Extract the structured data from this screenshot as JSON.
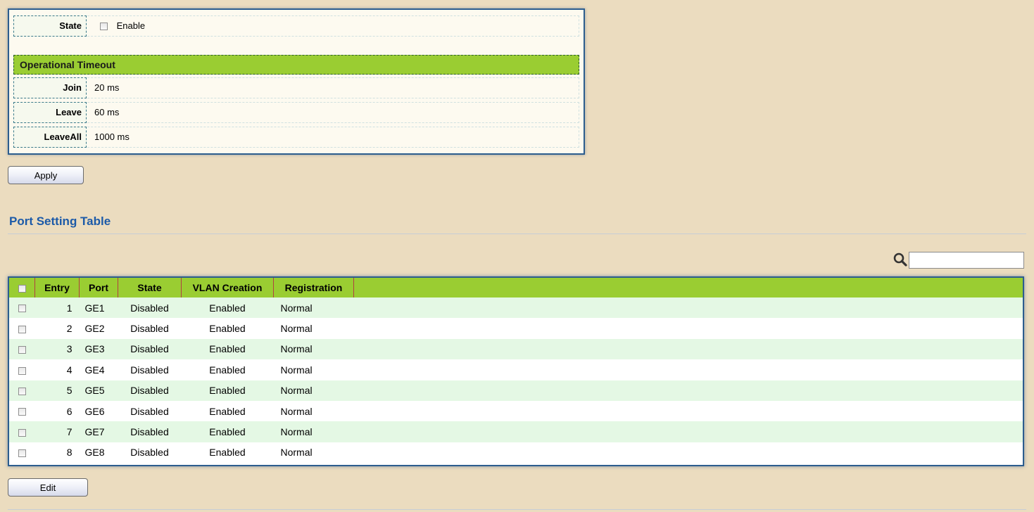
{
  "settings": {
    "state_label": "State",
    "enable_label": "Enable",
    "enable_checked": false,
    "section_title": "Operational Timeout",
    "join_label": "Join",
    "join_value": "20 ms",
    "leave_label": "Leave",
    "leave_value": "60 ms",
    "leaveall_label": "LeaveAll",
    "leaveall_value": "1000 ms"
  },
  "apply_button": "Apply",
  "port_table": {
    "title": "Port Setting Table",
    "search_value": "",
    "columns": [
      "Entry",
      "Port",
      "State",
      "VLAN Creation",
      "Registration"
    ],
    "rows": [
      {
        "entry": "1",
        "port": "GE1",
        "state": "Disabled",
        "vlan_creation": "Enabled",
        "registration": "Normal"
      },
      {
        "entry": "2",
        "port": "GE2",
        "state": "Disabled",
        "vlan_creation": "Enabled",
        "registration": "Normal"
      },
      {
        "entry": "3",
        "port": "GE3",
        "state": "Disabled",
        "vlan_creation": "Enabled",
        "registration": "Normal"
      },
      {
        "entry": "4",
        "port": "GE4",
        "state": "Disabled",
        "vlan_creation": "Enabled",
        "registration": "Normal"
      },
      {
        "entry": "5",
        "port": "GE5",
        "state": "Disabled",
        "vlan_creation": "Enabled",
        "registration": "Normal"
      },
      {
        "entry": "6",
        "port": "GE6",
        "state": "Disabled",
        "vlan_creation": "Enabled",
        "registration": "Normal"
      },
      {
        "entry": "7",
        "port": "GE7",
        "state": "Disabled",
        "vlan_creation": "Enabled",
        "registration": "Normal"
      },
      {
        "entry": "8",
        "port": "GE8",
        "state": "Disabled",
        "vlan_creation": "Enabled",
        "registration": "Normal"
      }
    ]
  },
  "edit_button": "Edit",
  "colors": {
    "background": "#ebdcbf",
    "header_green": "#9acd32",
    "title_blue": "#1c5aa8",
    "border_blue": "#2c5d8e",
    "row_alt": "#e4f8e4"
  },
  "icons": {
    "search": "search-icon"
  }
}
